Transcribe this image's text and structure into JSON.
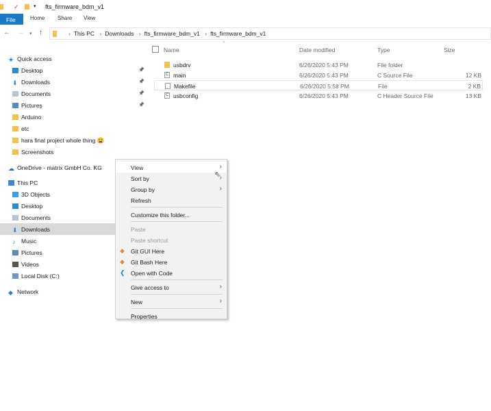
{
  "window": {
    "title": "fts_firmware_bdm_v1"
  },
  "ribbon": {
    "tabs": [
      "File",
      "Home",
      "Share",
      "View"
    ]
  },
  "address": {
    "crumbs": [
      "This PC",
      "Downloads",
      "fts_firmware_bdm_v1",
      "fts_firmware_bdm_v1"
    ]
  },
  "sidebar": {
    "items": [
      {
        "label": "Quick access",
        "icon": "star-icon",
        "color": "#2a7fd4",
        "indent": 0,
        "pinned": false
      },
      {
        "label": "Desktop",
        "icon": "desktop-icon",
        "color": "#2a8ad8",
        "indent": 1,
        "pinned": true
      },
      {
        "label": "Downloads",
        "icon": "download-icon",
        "color": "#2a7fd4",
        "indent": 1,
        "pinned": true
      },
      {
        "label": "Documents",
        "icon": "documents-icon",
        "color": "#b8c4cf",
        "indent": 1,
        "pinned": true
      },
      {
        "label": "Pictures",
        "icon": "pictures-icon",
        "color": "#5a8ab5",
        "indent": 1,
        "pinned": true
      },
      {
        "label": "Arduino",
        "icon": "folder-icon",
        "color": "#f2c14e",
        "indent": 1,
        "pinned": false
      },
      {
        "label": "etc",
        "icon": "folder-icon",
        "color": "#f2c14e",
        "indent": 1,
        "pinned": false
      },
      {
        "label": "hara final project whole thing 😫",
        "icon": "folder-star-icon",
        "color": "#f2c14e",
        "indent": 1,
        "pinned": false
      },
      {
        "label": "Screenshots",
        "icon": "folder-icon",
        "color": "#f2c14e",
        "indent": 1,
        "pinned": false
      },
      {
        "label": "OneDrive - matrix GmbH Co. KG",
        "icon": "cloud-icon",
        "color": "#1f6fc4",
        "indent": 0,
        "pinned": false
      },
      {
        "label": "This PC",
        "icon": "pc-icon",
        "color": "#3a8ad8",
        "indent": 0,
        "pinned": false
      },
      {
        "label": "3D Objects",
        "icon": "3d-objects-icon",
        "color": "#3aa0e0",
        "indent": 1,
        "pinned": false
      },
      {
        "label": "Desktop",
        "icon": "desktop-icon",
        "color": "#2a8ad8",
        "indent": 1,
        "pinned": false
      },
      {
        "label": "Documents",
        "icon": "documents-icon",
        "color": "#b8c4cf",
        "indent": 1,
        "pinned": false
      },
      {
        "label": "Downloads",
        "icon": "download-icon",
        "color": "#2a7fd4",
        "indent": 1,
        "pinned": false,
        "selected": true
      },
      {
        "label": "Music",
        "icon": "music-icon",
        "color": "#2a7fd4",
        "indent": 1,
        "pinned": false
      },
      {
        "label": "Pictures",
        "icon": "pictures-icon",
        "color": "#5a8ab5",
        "indent": 1,
        "pinned": false
      },
      {
        "label": "Videos",
        "icon": "videos-icon",
        "color": "#555",
        "indent": 1,
        "pinned": false
      },
      {
        "label": "Local Disk (C:)",
        "icon": "disk-icon",
        "color": "#6a9ac8",
        "indent": 1,
        "pinned": false
      },
      {
        "label": "Network",
        "icon": "network-icon",
        "color": "#2a7fd4",
        "indent": 0,
        "pinned": false
      }
    ]
  },
  "files": {
    "columns": [
      "Name",
      "Date modified",
      "Type",
      "Size"
    ],
    "rows": [
      {
        "name": "usbdrv",
        "date": "6/26/2020 5:43 PM",
        "type": "File folder",
        "size": "",
        "icon": "folder-icon"
      },
      {
        "name": "main",
        "date": "6/26/2020 5:43 PM",
        "type": "C Source File",
        "size": "12 KB",
        "icon": "c-file-icon"
      },
      {
        "name": "Makefile",
        "date": "6/26/2020 5:58 PM",
        "type": "File",
        "size": "2 KB",
        "icon": "file-icon"
      },
      {
        "name": "usbconfig",
        "date": "6/26/2020 5:43 PM",
        "type": "C Header Source File",
        "size": "13 KB",
        "icon": "c-file-icon"
      }
    ]
  },
  "context_menu": {
    "items": [
      {
        "label": "View",
        "submenu": true,
        "hot": true
      },
      {
        "label": "Sort by",
        "submenu": true
      },
      {
        "label": "Group by",
        "submenu": true
      },
      {
        "label": "Refresh"
      },
      {
        "sep": true
      },
      {
        "label": "Customize this folder..."
      },
      {
        "sep": true
      },
      {
        "label": "Paste",
        "disabled": true
      },
      {
        "label": "Paste shortcut",
        "disabled": true
      },
      {
        "label": "Git GUI Here",
        "icon": "git-icon"
      },
      {
        "label": "Git Bash Here",
        "icon": "git-icon"
      },
      {
        "label": "Open with Code",
        "icon": "vscode-icon"
      },
      {
        "sep": true
      },
      {
        "label": "Give access to",
        "submenu": true
      },
      {
        "sep": true
      },
      {
        "label": "New",
        "submenu": true
      },
      {
        "sep": true
      },
      {
        "label": "Properties"
      }
    ]
  }
}
